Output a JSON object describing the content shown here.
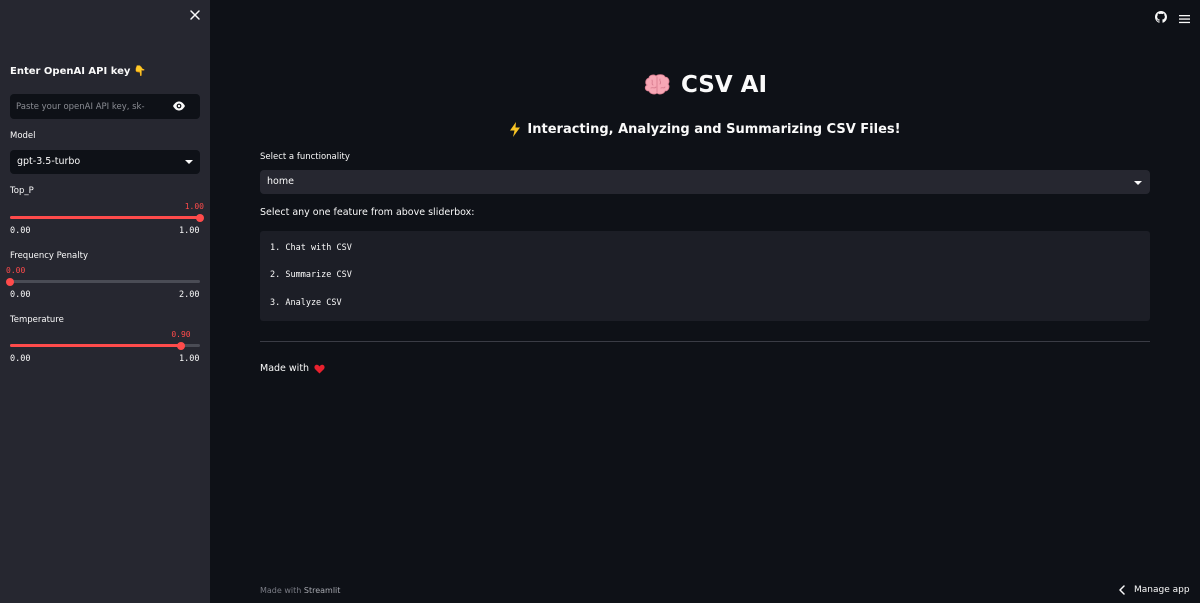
{
  "sidebar": {
    "api_heading": "Enter OpenAI API key",
    "api_placeholder": "Paste your openAI API key, sk-",
    "model_label": "Model",
    "model_value": "gpt-3.5-turbo",
    "top_p": {
      "label": "Top_P",
      "value": "1.00",
      "min": "0.00",
      "max": "1.00",
      "fraction": 1.0
    },
    "frequency_penalty": {
      "label": "Frequency Penalty",
      "value": "0.00",
      "min": "0.00",
      "max": "2.00",
      "fraction": 0.0
    },
    "temperature": {
      "label": "Temperature",
      "value": "0.90",
      "min": "0.00",
      "max": "1.00",
      "fraction": 0.9
    }
  },
  "main": {
    "title": "CSV AI",
    "subtitle": "Interacting, Analyzing and Summarizing CSV Files!",
    "functionality_label": "Select a functionality",
    "functionality_value": "home",
    "instructions": "Select any one feature from above sliderbox:",
    "features": [
      "1. Chat with CSV",
      "2. Summarize CSV",
      "3. Analyze CSV"
    ],
    "made_with": "Made with"
  },
  "footer": {
    "made_with": "Made with",
    "brand": "Streamlit",
    "manage_app": "Manage app"
  },
  "colors": {
    "accent": "#ff4b4b",
    "background": "#0e1117",
    "sidebar": "#262730"
  }
}
